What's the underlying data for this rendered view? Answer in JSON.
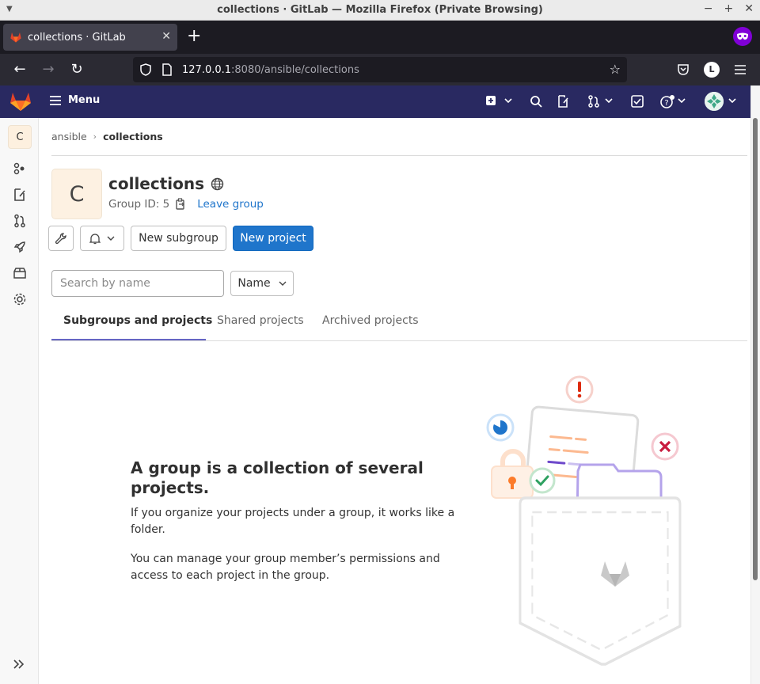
{
  "window": {
    "title": "collections · GitLab — Mozilla Firefox (Private Browsing)"
  },
  "browser": {
    "tab_title": "collections · GitLab",
    "url_host": "127.0.0.1",
    "url_rest": ":8080/ansible/collections",
    "profile_initial": "L"
  },
  "gitlab_header": {
    "menu_label": "Menu"
  },
  "sidebar": {
    "avatar_letter": "C"
  },
  "breadcrumb": {
    "parent": "ansible",
    "current": "collections"
  },
  "group": {
    "avatar_letter": "C",
    "name": "collections",
    "id_label": "Group ID: 5",
    "leave_label": "Leave group"
  },
  "actions": {
    "new_subgroup": "New subgroup",
    "new_project": "New project"
  },
  "filter": {
    "search_placeholder": "Search by name",
    "sort_label": "Name"
  },
  "tabs": [
    {
      "label": "Subgroups and projects",
      "active": true
    },
    {
      "label": "Shared projects",
      "active": false
    },
    {
      "label": "Archived projects",
      "active": false
    }
  ],
  "empty_state": {
    "title": "A group is a collection of several projects.",
    "paragraph1": "If you organize your projects under a group, it works like a folder.",
    "paragraph2": "You can manage your group member’s permissions and access to each project in the group."
  },
  "colors": {
    "gitlab_header": "#292961",
    "primary": "#1f75cb",
    "active_tab": "#6666c4"
  }
}
